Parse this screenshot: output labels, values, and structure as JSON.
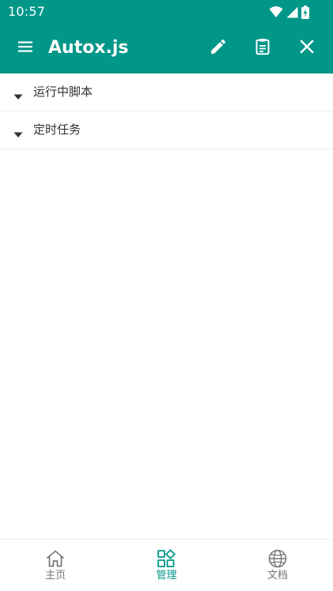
{
  "colors": {
    "primary": "#009688",
    "on_primary": "#ffffff",
    "text": "#333333",
    "inactive": "#777777"
  },
  "status_bar": {
    "time": "10:57",
    "icons": [
      "wifi-icon",
      "cell-signal-icon",
      "battery-charging-icon"
    ]
  },
  "app_bar": {
    "title": "Autox.js",
    "icons": [
      "menu-icon",
      "pencil-icon",
      "clipboard-icon",
      "close-icon"
    ]
  },
  "list": {
    "groups": [
      {
        "label": "运行中脚本",
        "expanded": true
      },
      {
        "label": "定时任务",
        "expanded": true
      }
    ]
  },
  "bottom_nav": {
    "active": "管理",
    "items": [
      {
        "label": "主页",
        "icon": "home-icon"
      },
      {
        "label": "管理",
        "icon": "grid-manage-icon"
      },
      {
        "label": "文档",
        "icon": "globe-icon"
      }
    ]
  }
}
